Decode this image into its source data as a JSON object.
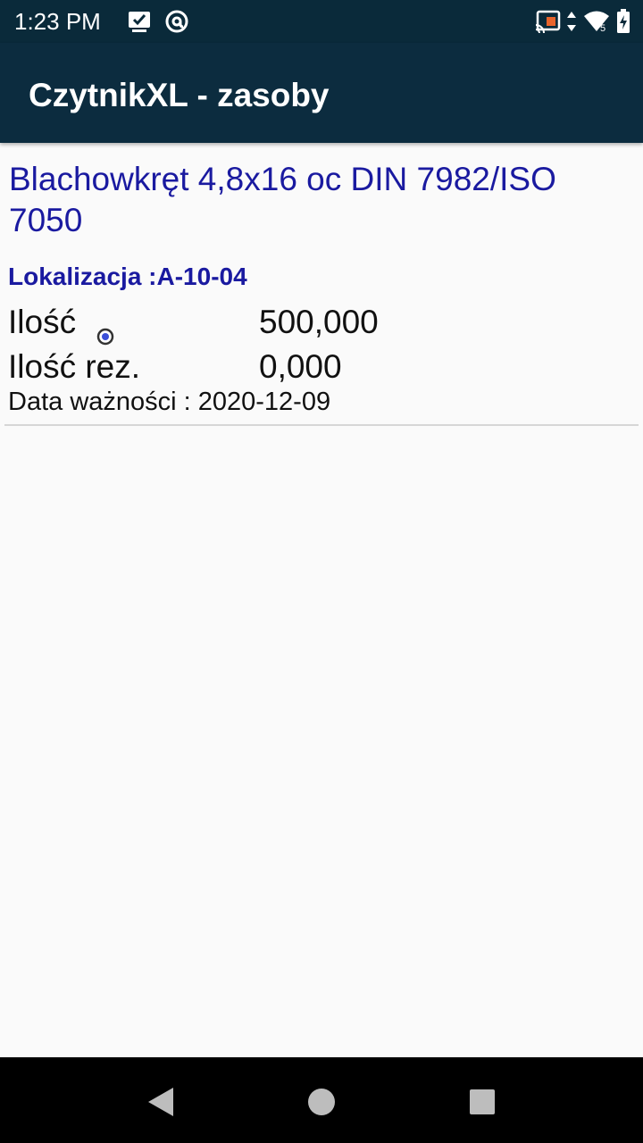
{
  "status_bar": {
    "time": "1:23 PM",
    "left_icons": [
      "checkbox-notification-icon",
      "at-sign-notification-icon"
    ],
    "right_icons": [
      "cast-icon",
      "data-arrows-icon",
      "wifi-icon",
      "battery-charging-icon"
    ],
    "wifi_label": "5"
  },
  "app_bar": {
    "title": "CzytnikXL - zasoby"
  },
  "item": {
    "name": "Blachowkręt 4,8x16 oc DIN 7982/ISO 7050",
    "location": "Lokalizacja :A-10-04",
    "quantity_label": "Ilość",
    "quantity_value": "500,000",
    "reserved_label": "Ilość rez.",
    "reserved_value": "0,000",
    "expiry": "Data ważności : 2020-12-09"
  },
  "nav_bar": {
    "buttons": [
      "back-icon",
      "home-icon",
      "recents-icon"
    ]
  },
  "colors": {
    "status_bar": "#0a2a3a",
    "app_bar": "#0c2c3f",
    "accent_text": "#1a1aa0",
    "background": "#fafafa"
  }
}
